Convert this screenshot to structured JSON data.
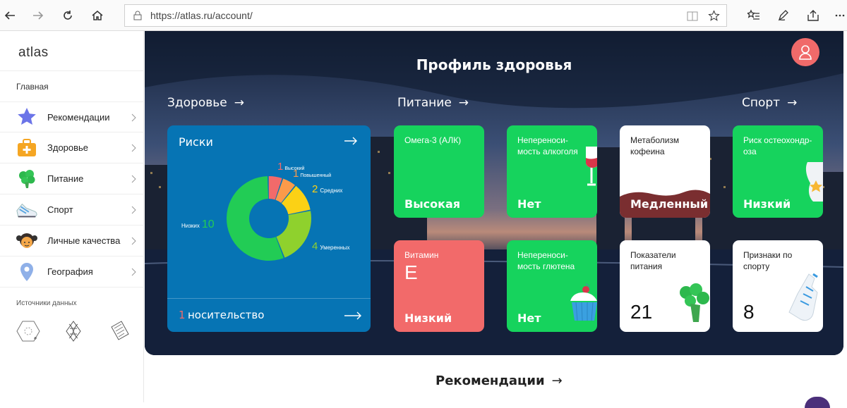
{
  "browser": {
    "url": "https://atlas.ru/account/"
  },
  "sidebar": {
    "logo": "atlas",
    "section_main": "Главная",
    "items": [
      {
        "label": "Рекомендации",
        "icon": "star-icon"
      },
      {
        "label": "Здоровье",
        "icon": "first-aid-kit-icon"
      },
      {
        "label": "Питание",
        "icon": "broccoli-icon"
      },
      {
        "label": "Спорт",
        "icon": "sneaker-icon"
      },
      {
        "label": "Личные качества",
        "icon": "girl-face-icon"
      },
      {
        "label": "География",
        "icon": "location-pin-icon"
      }
    ],
    "section_sources": "Источники данных",
    "source_icons": [
      "dna-kit-icon",
      "dna-helix-icon",
      "data-sheet-icon"
    ]
  },
  "hero": {
    "title": "Профиль здоровья",
    "columns": {
      "health": "Здоровье",
      "nutrition": "Питание",
      "sport": "Спорт"
    },
    "arrow": "→"
  },
  "risks": {
    "title": "Риски",
    "segments": [
      {
        "count": "1",
        "label": "Высокий",
        "color": "#f26a6a",
        "value": 1
      },
      {
        "count": "1",
        "label": "Повышенный",
        "color": "#fb9a4a",
        "value": 1
      },
      {
        "count": "2",
        "label": "Средних",
        "color": "#fbd115",
        "value": 2
      },
      {
        "count": "4",
        "label": "Умеренных",
        "color": "#8fd12d",
        "value": 4
      },
      {
        "count": "10",
        "label": "Низких",
        "color": "#22cc55",
        "value": 10
      }
    ],
    "carrier_count": "1",
    "carrier_label": "носительство"
  },
  "cards": {
    "omega": {
      "title": "Омега-3 (АЛК)",
      "value": "Высокая"
    },
    "alcohol": {
      "title": "Неперенoси-\nмость алкоголя",
      "value": "Нет"
    },
    "caffeine": {
      "title": "Метаболизм\nкофеина",
      "value": "Медленный"
    },
    "osteo": {
      "title": "Риск остеохондр-\nоза",
      "value": "Низкий"
    },
    "vitamin": {
      "title": "Витамин",
      "letter": "E",
      "value": "Низкий"
    },
    "gluten": {
      "title": "Неперенoси-\nмость глютена",
      "value": "Нет"
    },
    "nutrition_indicators": {
      "title": "Показатели\nпитания",
      "value": "21"
    },
    "sport_signs": {
      "title": "Признаки по\nспорту",
      "value": "8"
    }
  },
  "recommendations": {
    "title": "Рекомендации",
    "arrow": "→"
  }
}
